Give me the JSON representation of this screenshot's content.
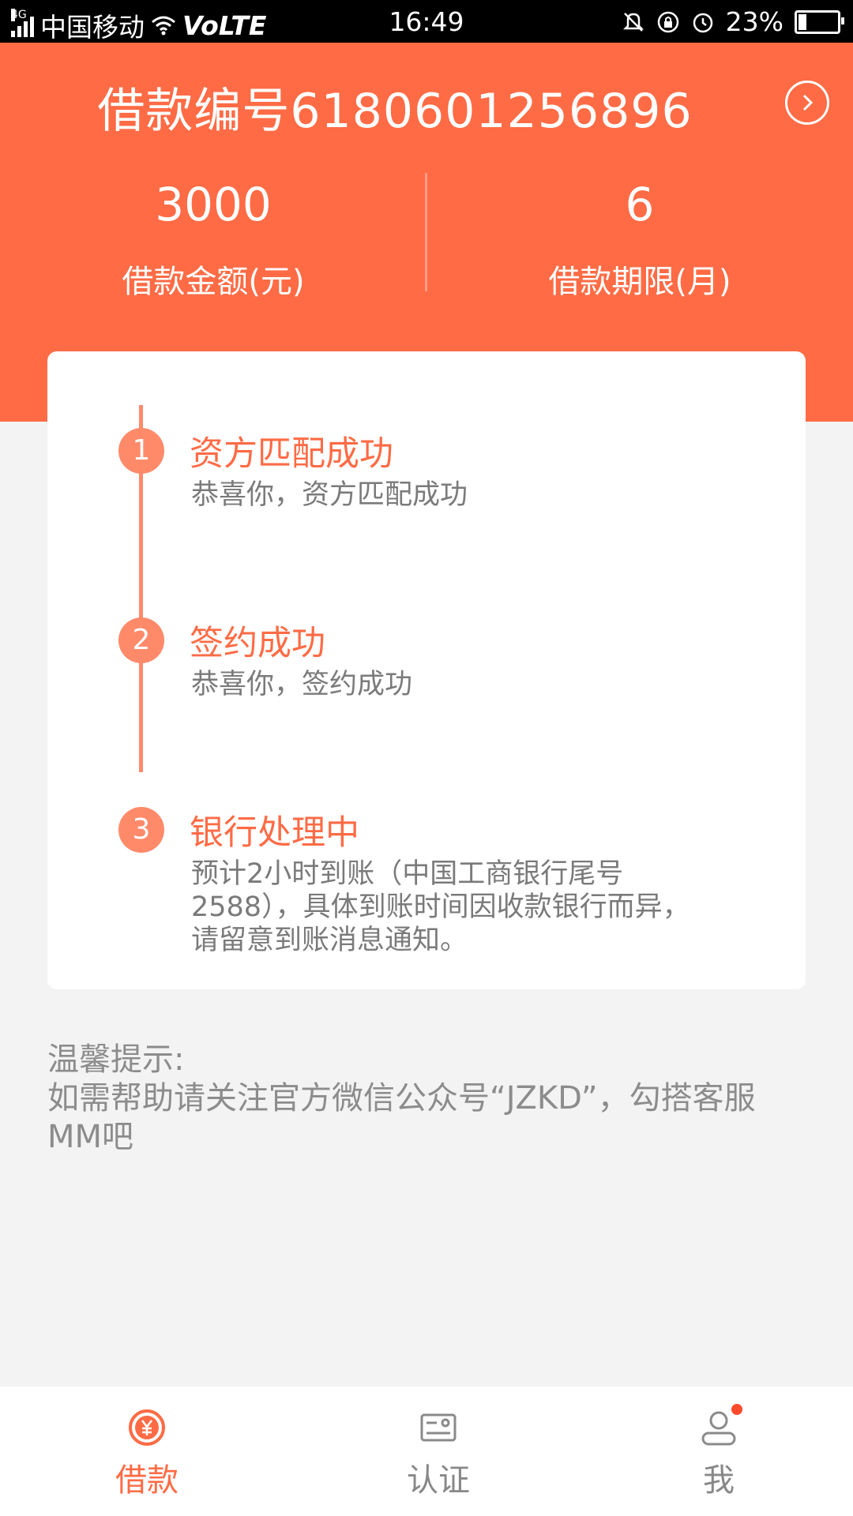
{
  "status_bar": {
    "network": "4G",
    "carrier": "中国移动",
    "volte": "VoLTE",
    "time": "16:49",
    "battery": "23%"
  },
  "header": {
    "loan_number_label": "借款编号6180601256896",
    "amount_value": "3000",
    "amount_label": "借款金额(元)",
    "term_value": "6",
    "term_label": "借款期限(月)"
  },
  "progress": {
    "steps": [
      {
        "index": "1",
        "title": "资方匹配成功",
        "desc": "恭喜你，资方匹配成功"
      },
      {
        "index": "2",
        "title": "签约成功",
        "desc": "恭喜你，签约成功"
      },
      {
        "index": "3",
        "title": "银行处理中",
        "desc": "预计2小时到账（中国工商银行尾号2588），具体到账时间因收款银行而异，请留意到账消息通知。"
      }
    ]
  },
  "tips": {
    "title": "温馨提示:",
    "body": "如需帮助请关注官方微信公众号“JZKD”，勾搭客服MM吧"
  },
  "bottom_nav": {
    "items": [
      {
        "label": "借款",
        "icon": "yen-icon",
        "active": true
      },
      {
        "label": "认证",
        "icon": "id-card-icon",
        "active": false
      },
      {
        "label": "我",
        "icon": "user-icon",
        "active": false
      }
    ]
  },
  "colors": {
    "accent": "#ff6b45",
    "accent_light": "#ff8a6a",
    "background": "#f3f3f3"
  }
}
